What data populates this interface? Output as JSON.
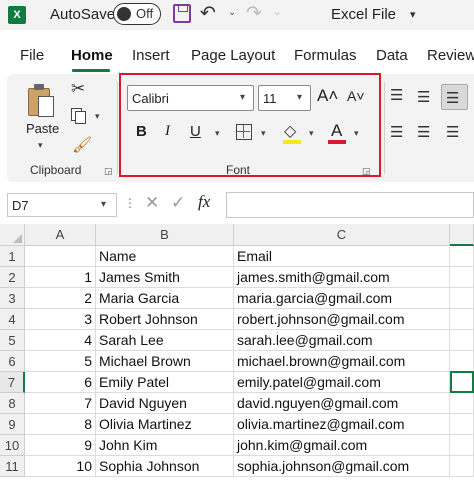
{
  "app": {
    "logo": "X",
    "autosave_label": "AutoSave",
    "autosave_state": "Off",
    "file_title": "Excel File"
  },
  "tabs": [
    {
      "label": "File"
    },
    {
      "label": "Home"
    },
    {
      "label": "Insert"
    },
    {
      "label": "Page Layout"
    },
    {
      "label": "Formulas"
    },
    {
      "label": "Data"
    },
    {
      "label": "Review"
    }
  ],
  "active_tab": "Home",
  "ribbon": {
    "clipboard": {
      "paste_label": "Paste",
      "group_label": "Clipboard"
    },
    "font": {
      "font_name": "Calibri",
      "font_size": "11",
      "grow": "A˄",
      "shrink": "A˅",
      "bold": "B",
      "italic": "I",
      "underline": "U",
      "fill_glyph": "◇",
      "font_color_glyph": "A",
      "fill_color": "#f6e51c",
      "font_color": "#d91a2a",
      "group_label": "Font"
    }
  },
  "formula_bar": {
    "name_box": "D7",
    "fx": "fx",
    "cancel": "✕",
    "enter": "✓",
    "value": ""
  },
  "sheet": {
    "columns": [
      "A",
      "B",
      "C"
    ],
    "rows": [
      {
        "num": "1",
        "a": "",
        "b": "Name",
        "c": "Email"
      },
      {
        "num": "2",
        "a": "1",
        "b": "James Smith",
        "c": "james.smith@gmail.com"
      },
      {
        "num": "3",
        "a": "2",
        "b": "Maria Garcia",
        "c": "maria.garcia@gmail.com"
      },
      {
        "num": "4",
        "a": "3",
        "b": "Robert Johnson",
        "c": "robert.johnson@gmail.com"
      },
      {
        "num": "5",
        "a": "4",
        "b": "Sarah Lee",
        "c": "sarah.lee@gmail.com"
      },
      {
        "num": "6",
        "a": "5",
        "b": "Michael Brown",
        "c": "michael.brown@gmail.com"
      },
      {
        "num": "7",
        "a": "6",
        "b": "Emily Patel",
        "c": "emily.patel@gmail.com"
      },
      {
        "num": "8",
        "a": "7",
        "b": "David Nguyen",
        "c": "david.nguyen@gmail.com"
      },
      {
        "num": "9",
        "a": "8",
        "b": "Olivia Martinez",
        "c": "olivia.martinez@gmail.com"
      },
      {
        "num": "10",
        "a": "9",
        "b": "John Kim",
        "c": "john.kim@gmail.com"
      },
      {
        "num": "11",
        "a": "10",
        "b": "Sophia Johnson",
        "c": "sophia.johnson@gmail.com"
      }
    ]
  },
  "colors": {
    "accent": "#107c41",
    "highlight_border": "#d91a2a"
  }
}
